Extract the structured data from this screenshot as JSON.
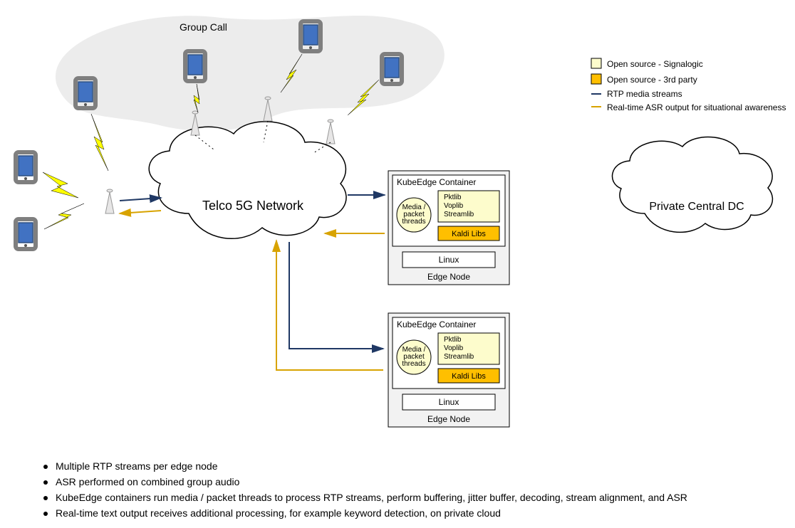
{
  "group": {
    "label": "Group Call"
  },
  "cloud1": {
    "label": "Telco 5G Network"
  },
  "cloud2": {
    "label": "Private Central DC"
  },
  "node": {
    "container": "KubeEdge Container",
    "threads": "Media /\npacket\nthreads",
    "lib1": "Pktlib",
    "lib2": "Voplib",
    "lib3": "Streamlib",
    "kaldi": "Kaldi Libs",
    "os": "Linux",
    "label": "Edge Node"
  },
  "legend": {
    "l1": "Open source - Signalogic",
    "l2": "Open source - 3rd party",
    "l3": "RTP media streams",
    "l4": "Real-time ASR output for situational awareness"
  },
  "foot": {
    "f1": "Multiple RTP streams per edge node",
    "f2": "ASR performed on combined group audio",
    "f3": "KubeEdge containers run media / packet threads to process RTP streams, perform buffering, jitter buffer, decoding, stream alignment, and ASR",
    "f4": "Real-time text output receives additional processing, for example keyword detection, on private cloud"
  }
}
